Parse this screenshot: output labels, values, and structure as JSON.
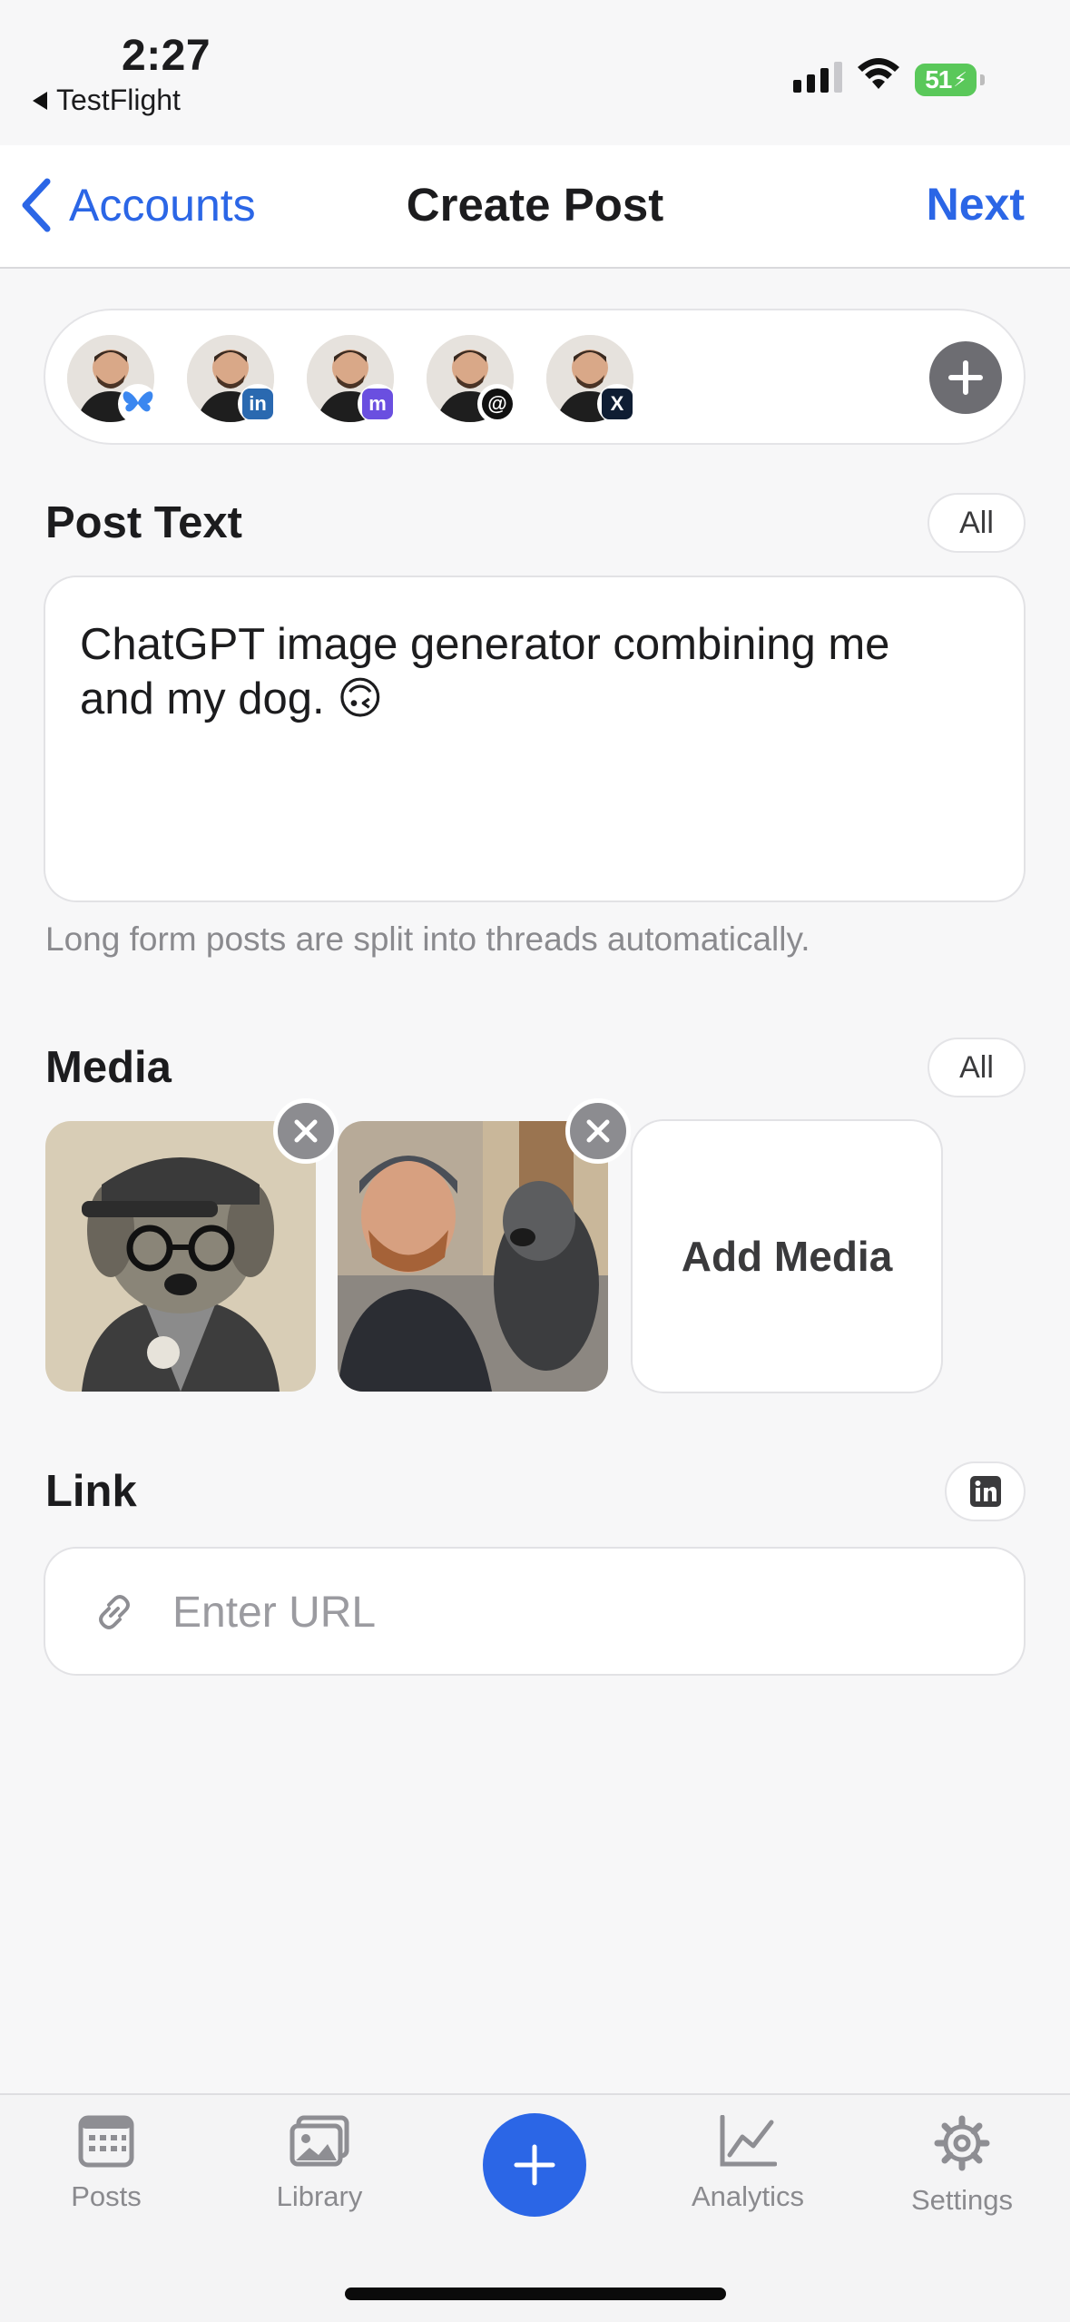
{
  "status_bar": {
    "time": "2:27",
    "back_app": "TestFlight",
    "battery": "51"
  },
  "nav": {
    "back_label": "Accounts",
    "title": "Create Post",
    "next_label": "Next"
  },
  "accounts": [
    {
      "network": "bluesky-icon"
    },
    {
      "network": "linkedin-icon",
      "badge_text": "in"
    },
    {
      "network": "mastodon-icon",
      "badge_text": "m"
    },
    {
      "network": "threads-icon",
      "badge_text": "@"
    },
    {
      "network": "x-icon",
      "badge_text": "X"
    }
  ],
  "post_text": {
    "title": "Post Text",
    "scope": "All",
    "value": "ChatGPT image generator combining me and my dog. 🙃",
    "hint": "Long form posts are split into threads automatically."
  },
  "media": {
    "title": "Media",
    "scope": "All",
    "add_label": "Add Media",
    "items": [
      "illustrated-dog-image",
      "photo-man-with-dog-image"
    ]
  },
  "link": {
    "title": "Link",
    "placeholder": "Enter URL",
    "value": ""
  },
  "tabs": [
    {
      "label": "Posts",
      "icon": "calendar-icon"
    },
    {
      "label": "Library",
      "icon": "photos-icon"
    },
    {
      "label": "Analytics",
      "icon": "chart-icon"
    },
    {
      "label": "Settings",
      "icon": "gear-icon"
    }
  ],
  "colors": {
    "accent": "#2b66e6",
    "background": "#f7f7f8"
  }
}
